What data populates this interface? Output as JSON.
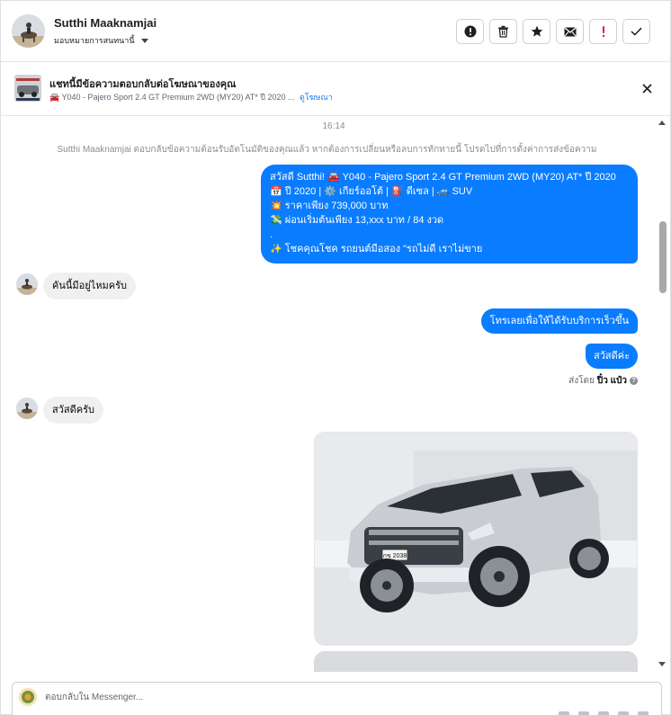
{
  "header": {
    "contact_name": "Sutthi Maaknamjai",
    "assign_label": "มอบหมายการสนทนานี้",
    "actions": [
      {
        "name": "mark-spam",
        "icon": "alert-circle-icon"
      },
      {
        "name": "delete",
        "icon": "trash-icon"
      },
      {
        "name": "star",
        "icon": "star-icon"
      },
      {
        "name": "mark-unread",
        "icon": "envelope-icon"
      },
      {
        "name": "follow-up",
        "icon": "exclamation-icon"
      },
      {
        "name": "mark-done",
        "icon": "check-icon"
      }
    ]
  },
  "ad_banner": {
    "title": "แชทนี้มีข้อความตอบกลับต่อโฆษณาของคุณ",
    "subtitle": "🚘 Y040 - Pajero Sport 2.4 GT Premium 2WD (MY20) AT* ปี 2020 ...",
    "link": "ดูโฆษณา"
  },
  "chat": {
    "timestamp": "16:14",
    "notice": "Sutthi Maaknamjai ตอบกลับข้อความต้อนรับอัตโนมัติของคุณแล้ว หากต้องการเปลี่ยนหรือลบการทักทายนี้ โปรดไปที่การตั้งค่าการส่งข้อความ",
    "messages": {
      "welcome": {
        "lines": [
          "สวัสดี Sutthi! 🚘 Y040 - Pajero Sport 2.4 GT Premium 2WD (MY20) AT* ปี 2020",
          "📅 ปี 2020 | ⚙️ เกียร์ออโต้ | ⛽ ดีเซล | 🚙 SUV",
          "💥 ราคาเพียง 739,000 บาท",
          "💸 ผ่อนเริ่มต้นเพียง 13,xxx บาท / 84 งวด",
          ".",
          "✨ โชคคุณโชค รถยนต์มือสอง \"รถไม่ดี เราไม่ขาย"
        ]
      },
      "incoming_1": "คันนี้มีอยู่ไหมครับ",
      "outgoing_1": "โทรเลยเพื่อให้ได้รับบริการเร็วขึ้น",
      "outgoing_2": "สวัสดีค่ะ",
      "sent_by_prefix": "ส่งโดย",
      "sent_by_name": "ปิ๋ว แป๋ว",
      "incoming_2": "สวัสดีครับ"
    },
    "image_caption_plate": "กข 2038"
  },
  "composer": {
    "placeholder": "ตอบกลับใน Messenger..."
  },
  "colors": {
    "outgoing_bubble": "#0a7cff",
    "incoming_bubble": "#f0f0f0",
    "link": "#1877f2",
    "follow_up_red": "#e41e3f"
  }
}
